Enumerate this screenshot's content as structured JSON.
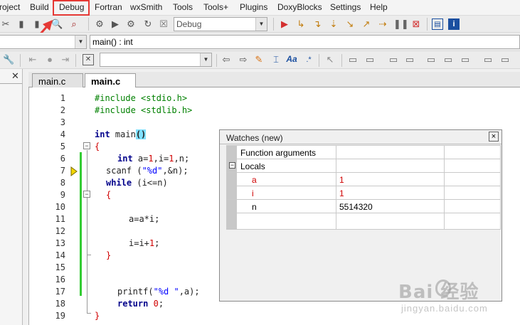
{
  "menu": {
    "items": [
      "roject",
      "Build",
      "Debug",
      "Fortran",
      "wxSmith",
      "Tools",
      "Tools+",
      "Plugins",
      "DoxyBlocks",
      "Settings",
      "Help"
    ],
    "highlighted": "Debug",
    "highlight_color": "#e53935"
  },
  "toolbar": {
    "build_target": "Debug",
    "function_selector": "main() : int",
    "search_combo": ""
  },
  "tabs": [
    {
      "label": "main.c",
      "active": false
    },
    {
      "label": "main.c",
      "active": true
    }
  ],
  "editor": {
    "line_numbers": [
      "1",
      "2",
      "3",
      "4",
      "5",
      "6",
      "7",
      "8",
      "9",
      "10",
      "11",
      "12",
      "13",
      "14",
      "15",
      "16",
      "17",
      "18",
      "19"
    ],
    "lines": {
      "l1": "#include <stdio.h>",
      "l2": "#include <stdlib.h>",
      "l4_kw": "int",
      "l4_rest": " main",
      "l4_paren": "()",
      "l5": "{",
      "l6_kw": "int",
      "l6_rest": " a=",
      "l6_n1": "1",
      "l6_mid": ",i=",
      "l6_n2": "1",
      "l6_end": ",n;",
      "l7_a": "scanf (",
      "l7_str": "\"%d\"",
      "l7_b": ",&n);",
      "l8_kw": "while",
      "l8_rest": " (i<=n)",
      "l9": "{",
      "l11": "a=a*i;",
      "l13_a": "i=i+",
      "l13_n": "1",
      "l13_b": ";",
      "l14": "}",
      "l17_a": "printf(",
      "l17_str": "\"%d \"",
      "l17_b": ",a);",
      "l18_kw": "return",
      "l18_sp": " ",
      "l18_n": "0",
      "l18_b": ";",
      "l19": "}"
    },
    "current_line": 7
  },
  "watches": {
    "title": "Watches (new)",
    "close": "×",
    "rows": [
      {
        "name": "Function arguments",
        "value": ""
      },
      {
        "name": "Locals",
        "value": "",
        "expanded": true
      },
      {
        "name": "a",
        "value": "1",
        "changed": true
      },
      {
        "name": "i",
        "value": "1",
        "changed": true
      },
      {
        "name": "n",
        "value": "5514320",
        "changed": false
      }
    ],
    "expander": "−"
  },
  "watermark": {
    "main": "Bai  经验",
    "sub": "jingyan.baidu.com"
  }
}
